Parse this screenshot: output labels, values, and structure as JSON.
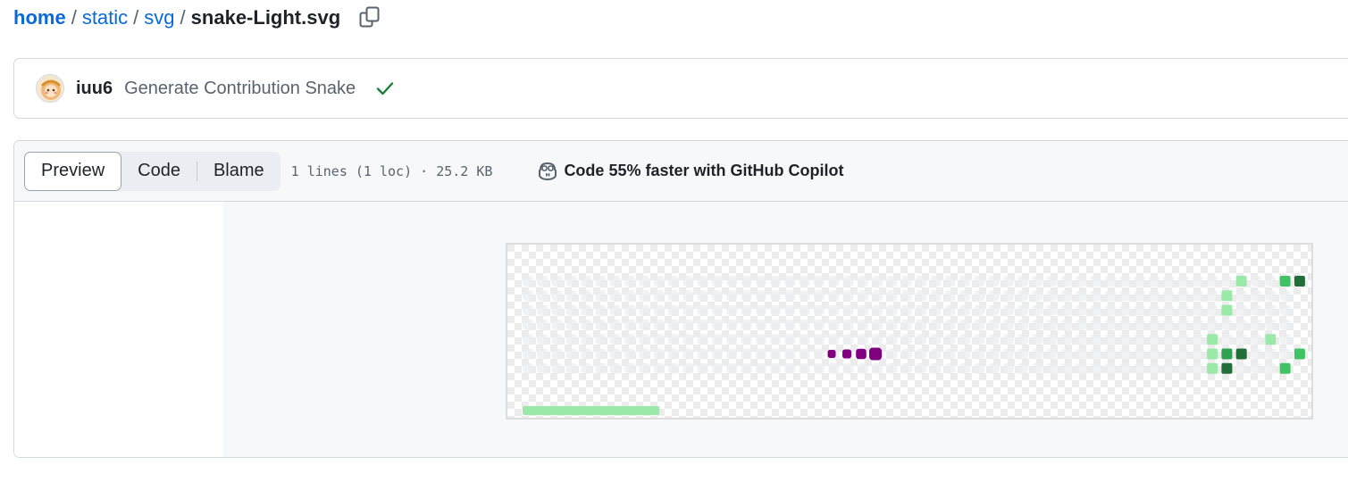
{
  "breadcrumb": {
    "items": [
      "home",
      "static",
      "svg"
    ],
    "separator": "/",
    "current": "snake-Light.svg"
  },
  "commit": {
    "author": "iuu6",
    "message": "Generate Contribution Snake",
    "status": "check-icon"
  },
  "file_header": {
    "tabs": {
      "preview": "Preview",
      "code": "Code",
      "blame": "Blame"
    },
    "active_tab": "Preview",
    "file_info": "1 lines (1 loc) · 25.2 KB",
    "copilot_text": "Code 55% faster with GitHub Copilot"
  },
  "colors": {
    "link": "#0969da",
    "snake": "#800080",
    "empty_cell": "#ebedf0",
    "green_level_1": "#9be9a8",
    "green_level_2": "#40c463",
    "green_level_3": "#30a14e",
    "green_level_4": "#216e39",
    "progress_bar": "#9be9a8"
  },
  "snake_preview": {
    "progress": 0.17
  }
}
